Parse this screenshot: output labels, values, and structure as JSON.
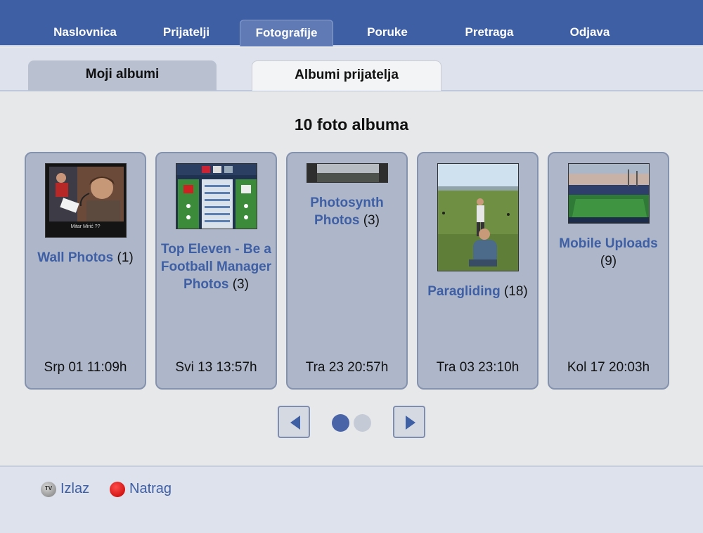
{
  "topnav": {
    "items": [
      {
        "label": "Naslovnica"
      },
      {
        "label": "Prijatelji"
      },
      {
        "label": "Fotografije",
        "active": true
      },
      {
        "label": "Poruke"
      },
      {
        "label": "Pretraga"
      },
      {
        "label": "Odjava"
      }
    ]
  },
  "subtabs": {
    "my_albums": "Moji albumi",
    "friends_albums": "Albumi prijatelja"
  },
  "main": {
    "count_title": "10 foto albuma",
    "albums": [
      {
        "name": "Wall Photos",
        "count": "(1)",
        "date": "Srp 01 11:09h",
        "thumb_caption": "Mitar Mirić ??"
      },
      {
        "name": "Top Eleven - Be a Football Manager Photos",
        "count": "(3)",
        "date": "Svi 13 13:57h"
      },
      {
        "name": "Photosynth Photos",
        "count": "(3)",
        "date": "Tra 23 20:57h"
      },
      {
        "name": "Paragliding",
        "count": "(18)",
        "date": "Tra 03 23:10h"
      },
      {
        "name": "Mobile Uploads",
        "count": "(9)",
        "date": "Kol 17 20:03h"
      }
    ]
  },
  "pager": {
    "prev_icon": "arrow-left-icon",
    "next_icon": "arrow-right-icon",
    "pages": 2,
    "current": 1
  },
  "footer": {
    "exit_label": "Izlaz",
    "exit_icon_text": "TV",
    "back_label": "Natrag"
  },
  "colors": {
    "brand": "#3f5fa5",
    "card": "#aeb7c9",
    "dot_active": "#4a64a8",
    "dot_inactive": "#c4cad6",
    "back_red": "#d40000"
  }
}
